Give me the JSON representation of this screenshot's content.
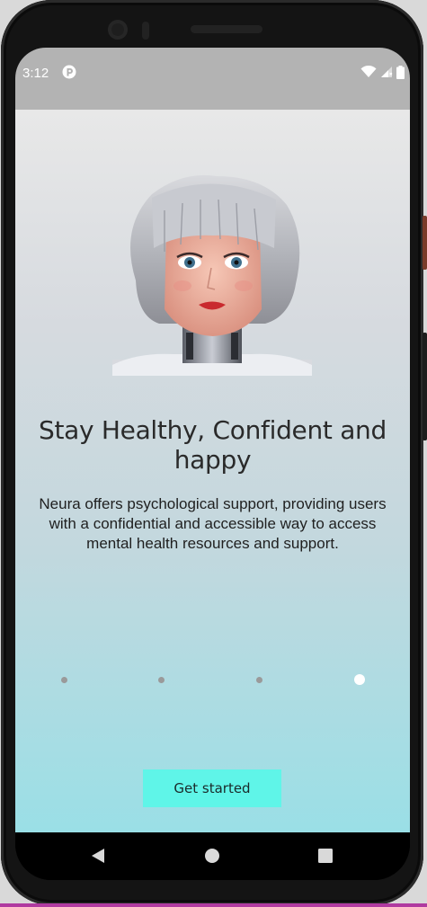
{
  "status_bar": {
    "time": "3:12",
    "app_icon": "app-notification-icon",
    "wifi_icon": "wifi-icon",
    "signal_icon": "cell-signal-icon",
    "battery_icon": "battery-icon"
  },
  "onboarding": {
    "title": "Stay Healthy, Confident and happy",
    "description": "Neura offers psychological support, providing users with a confidential and accessible way to access mental health resources and support.",
    "hero_image": "robot-woman-illustration",
    "pagination": {
      "total_pages": 4,
      "active_index": 3
    },
    "cta_label": "Get started"
  },
  "colors": {
    "status_bar": "#b3b3b3",
    "gradient_top": "#e8e8e8",
    "gradient_bottom": "#9adfe6",
    "button": "#5ff5e8",
    "dot_inactive": "#9a9a9a",
    "dot_active": "#ffffff"
  },
  "navigation": {
    "back_icon": "back-triangle-icon",
    "home_icon": "home-circle-icon",
    "recents_icon": "recents-square-icon"
  }
}
